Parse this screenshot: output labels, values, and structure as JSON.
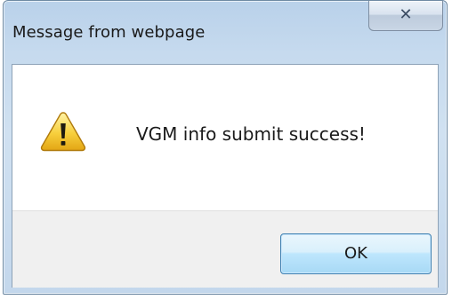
{
  "dialog": {
    "title": "Message from webpage",
    "close_icon": "close-icon",
    "message": "VGM info submit success!",
    "warning_icon": "warning-icon",
    "ok_label": "OK"
  },
  "colors": {
    "frame": "#c6daee",
    "button_bar": "#f0f0f0",
    "ok_button": "#bee6fd"
  }
}
